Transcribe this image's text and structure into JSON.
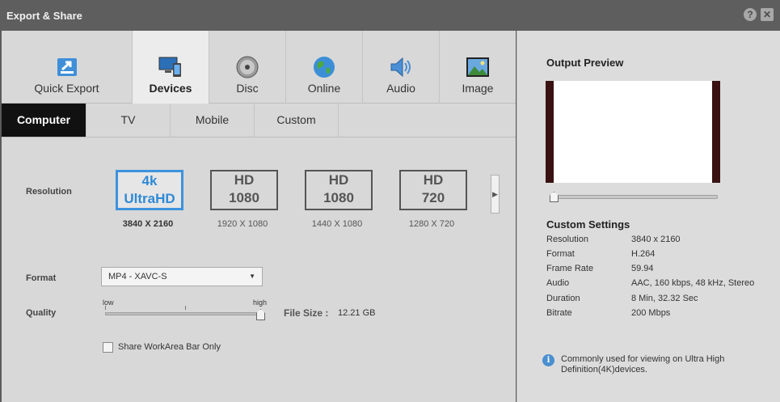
{
  "window": {
    "title": "Export & Share",
    "help_label": "?",
    "close_label": "✕"
  },
  "tabs": [
    {
      "label": "Quick Export",
      "icon": "quick-export-icon"
    },
    {
      "label": "Devices",
      "icon": "devices-icon",
      "active": true
    },
    {
      "label": "Disc",
      "icon": "disc-icon"
    },
    {
      "label": "Online",
      "icon": "globe-icon"
    },
    {
      "label": "Audio",
      "icon": "speaker-icon"
    },
    {
      "label": "Image",
      "icon": "picture-icon"
    }
  ],
  "subtabs": [
    {
      "label": "Computer",
      "active": true
    },
    {
      "label": "TV"
    },
    {
      "label": "Mobile"
    },
    {
      "label": "Custom"
    }
  ],
  "resolution": {
    "label": "Resolution",
    "options": [
      {
        "line1": "4k",
        "line2": "UltraHD",
        "caption": "3840 X 2160",
        "active": true
      },
      {
        "line1": "HD",
        "line2": "1080",
        "caption": "1920 X 1080"
      },
      {
        "line1": "HD",
        "line2": "1080",
        "caption": "1440 X 1080"
      },
      {
        "line1": "HD",
        "line2": "720",
        "caption": "1280 X 720"
      }
    ],
    "next_icon": "chevron-right-icon"
  },
  "format": {
    "label": "Format",
    "value": "MP4 - XAVC-S"
  },
  "quality": {
    "label": "Quality",
    "low": "low",
    "high": "high",
    "level": 1.0
  },
  "filesize": {
    "label": "File Size :",
    "value": "12.21 GB"
  },
  "workarea": {
    "label": "Share WorkArea Bar Only",
    "checked": false
  },
  "preview": {
    "title": "Output Preview",
    "position": 0.0
  },
  "custom_settings": {
    "title": "Custom Settings",
    "rows": [
      {
        "k": "Resolution",
        "v": "3840 x 2160"
      },
      {
        "k": "Format",
        "v": "H.264"
      },
      {
        "k": "Frame Rate",
        "v": "59.94"
      },
      {
        "k": "Audio",
        "v": "AAC, 160 kbps, 48 kHz, Stereo"
      },
      {
        "k": "Duration",
        "v": "8 Min, 32.32 Sec"
      },
      {
        "k": "Bitrate",
        "v": "200 Mbps"
      }
    ]
  },
  "info": {
    "icon": "info-icon",
    "icon_label": "i",
    "text": "Commonly used for viewing on Ultra High Definition(4K)devices."
  },
  "colors": {
    "accent": "#3d93dd",
    "active_subtab": "#111111"
  }
}
